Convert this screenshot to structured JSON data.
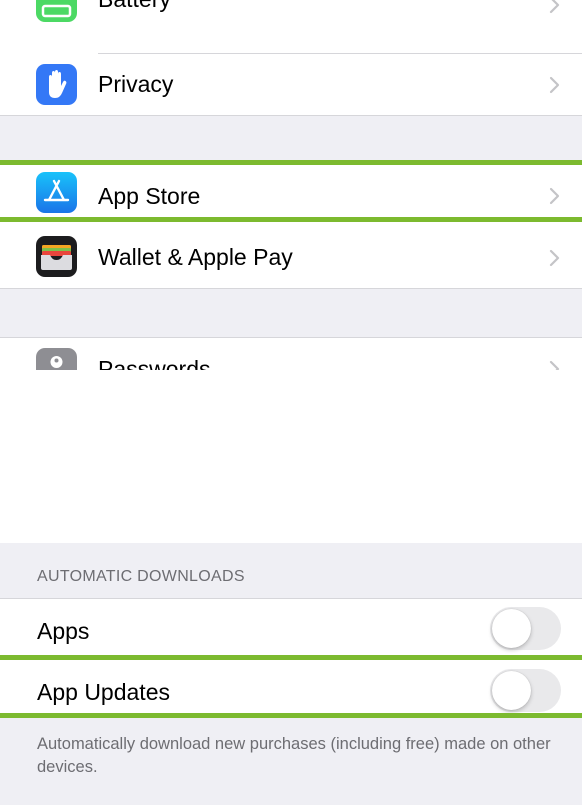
{
  "settings_list": {
    "items": [
      {
        "label": "Battery",
        "icon": "battery-icon"
      },
      {
        "label": "Privacy",
        "icon": "hand-icon"
      },
      {
        "label": "App Store",
        "icon": "app-store-icon"
      },
      {
        "label": "Wallet & Apple Pay",
        "icon": "wallet-icon"
      },
      {
        "label": "Passwords",
        "icon": "key-icon"
      }
    ]
  },
  "automatic_downloads": {
    "header": "AUTOMATIC DOWNLOADS",
    "apps_label": "Apps",
    "apps_on": false,
    "app_updates_label": "App Updates",
    "app_updates_on": false,
    "footer": "Automatically download new purchases (including free) made on other devices."
  },
  "colors": {
    "highlight": "#7cba2f",
    "grouped_background": "#efeff4",
    "battery_icon": "#4cd964",
    "privacy_icon": "#3478f6",
    "app_store_icon": "#1a8cf5",
    "wallet_icon": "#1c1c1e",
    "passwords_icon": "#8e8e93"
  }
}
